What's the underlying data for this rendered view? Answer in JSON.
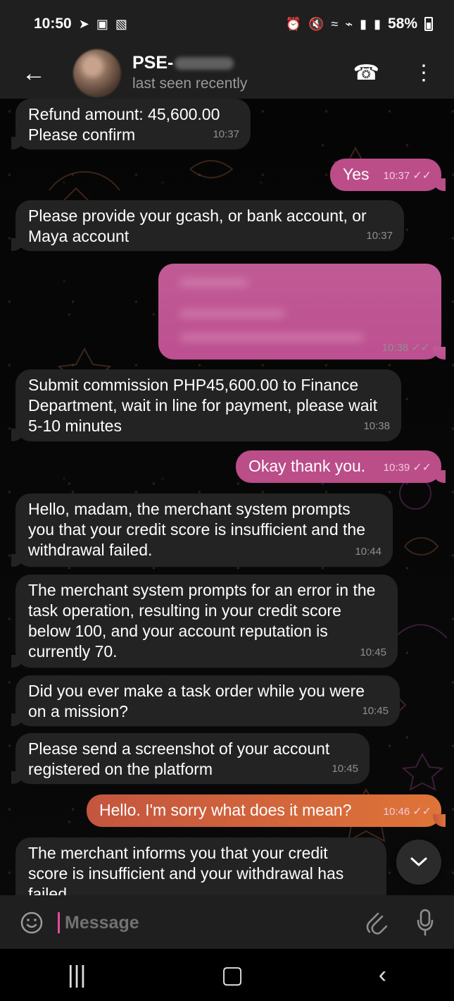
{
  "status_bar": {
    "time": "10:50",
    "battery": "58%",
    "icons": [
      "location-arrow-icon",
      "shopping-bag-icon",
      "image-icon",
      "alarm-icon",
      "mute-icon",
      "wifi-icon",
      "volte-icon",
      "signal-icon",
      "signal-icon",
      "battery-icon"
    ]
  },
  "header": {
    "back_icon": "arrow-left-icon",
    "contact_name": "PSE-",
    "last_seen": "last seen recently",
    "call_icon": "phone-icon",
    "menu_icon": "more-vertical-icon"
  },
  "messages": [
    {
      "side": "in",
      "text": "Refund amount: 45,600.00\nPlease confirm",
      "time": "10:37"
    },
    {
      "side": "out",
      "text": "Yes",
      "time": "10:37"
    },
    {
      "side": "in",
      "text": "Please provide your gcash, or bank account, or Maya account",
      "time": "10:37"
    },
    {
      "side": "out",
      "text": "",
      "time": "10:38"
    },
    {
      "side": "in",
      "text": "Submit commission PHP45,600.00 to Finance Department, wait in line for payment, please wait 5-10 minutes",
      "time": "10:38"
    },
    {
      "side": "out",
      "text": "Okay thank you.",
      "time": "10:39"
    },
    {
      "side": "in",
      "text": "Hello, madam, the merchant system prompts you that your credit score is insufficient and the withdrawal failed.",
      "time": "10:44"
    },
    {
      "side": "in",
      "text": "The merchant system prompts for an error in the task operation, resulting in your credit score below 100, and your account reputation is currently 70.",
      "time": "10:45"
    },
    {
      "side": "in",
      "text": "Did you ever make a task order while you were on a mission?",
      "time": "10:45"
    },
    {
      "side": "in",
      "text": "Please send a screenshot of your account registered on the platform",
      "time": "10:45"
    },
    {
      "side": "out",
      "text": "Hello. I'm sorry what does it mean?",
      "time": "10:46"
    },
    {
      "side": "in",
      "text": "The merchant informs you that your credit score is insufficient and your withdrawal has failed",
      "time": ""
    }
  ],
  "composer": {
    "placeholder": "Message",
    "emoji_icon": "smile-icon",
    "attach_icon": "paperclip-icon",
    "mic_icon": "microphone-icon"
  },
  "nav": {
    "recent_icon": "recent-apps-icon",
    "home_icon": "home-icon",
    "back_icon": "back-icon"
  },
  "colors": {
    "incoming": "#232323",
    "outgoing_pink": "#bb4d89",
    "outgoing_orange": "#d76f39",
    "accent": "#e24b9b"
  }
}
